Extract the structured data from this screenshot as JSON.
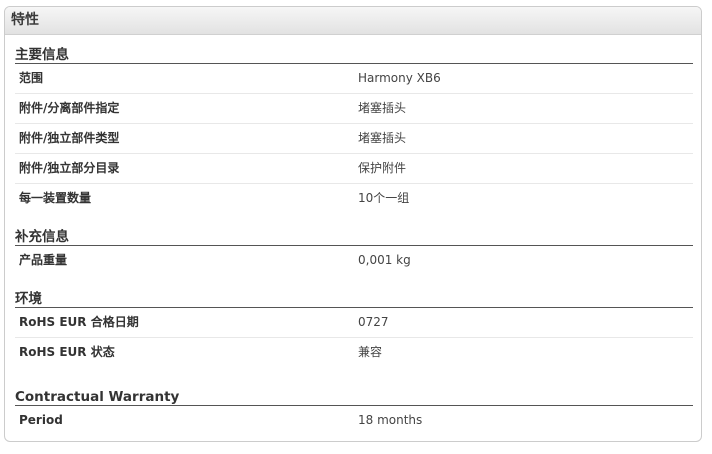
{
  "panel": {
    "title": "特性"
  },
  "sections": [
    {
      "title": "主要信息",
      "rows": [
        {
          "label": "范围",
          "value": "Harmony XB6"
        },
        {
          "label": "附件/分离部件指定",
          "value": "堵塞插头"
        },
        {
          "label": "附件/独立部件类型",
          "value": "堵塞插头"
        },
        {
          "label": "附件/独立部分目录",
          "value": "保护附件"
        },
        {
          "label": "每一装置数量",
          "value": "10个一组"
        }
      ]
    },
    {
      "title": "补充信息",
      "rows": [
        {
          "label": "产品重量",
          "value": "0,001 kg"
        }
      ]
    },
    {
      "title": "环境",
      "rows": [
        {
          "label": "RoHS EUR 合格日期",
          "value": "0727"
        },
        {
          "label": "RoHS EUR 状态",
          "value": "兼容"
        }
      ]
    },
    {
      "title": "Contractual Warranty",
      "rows": [
        {
          "label": "Period",
          "value": "18 months"
        }
      ]
    }
  ]
}
